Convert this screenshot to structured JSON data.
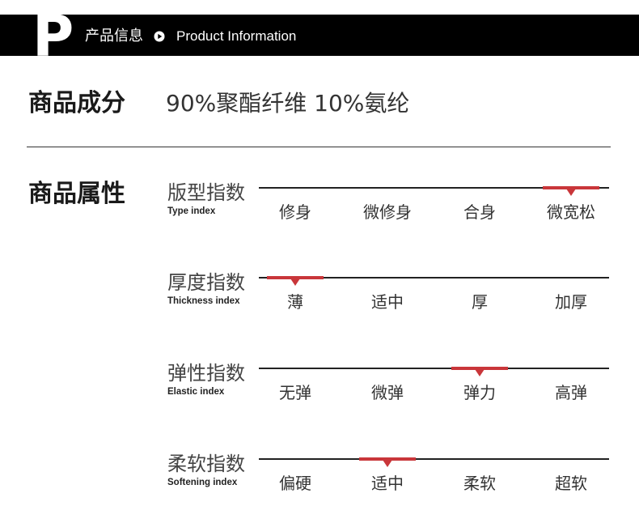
{
  "header": {
    "logo_letter": "P",
    "title_cn": "产品信息",
    "title_en": "Product Information",
    "separator_icon": "play-circle-icon"
  },
  "composition": {
    "label": "商品成分",
    "value": "90%聚酯纤维 10%氨纶"
  },
  "attributes": {
    "label": "商品属性",
    "rows": [
      {
        "name_cn": "版型指数",
        "name_en": "Type index",
        "options": [
          "修身",
          "微修身",
          "合身",
          "微宽松"
        ],
        "selected": 3
      },
      {
        "name_cn": "厚度指数",
        "name_en": "Thickness index",
        "options": [
          "薄",
          "适中",
          "厚",
          "加厚"
        ],
        "selected": 0
      },
      {
        "name_cn": "弹性指数",
        "name_en": "Elastic index",
        "options": [
          "无弹",
          "微弹",
          "弹力",
          "高弹"
        ],
        "selected": 2
      },
      {
        "name_cn": "柔软指数",
        "name_en": "Softening index",
        "options": [
          "偏硬",
          "适中",
          "柔软",
          "超软"
        ],
        "selected": 1
      }
    ]
  },
  "colors": {
    "header_bg": "#000000",
    "accent": "#c9363a",
    "text": "#222222"
  }
}
